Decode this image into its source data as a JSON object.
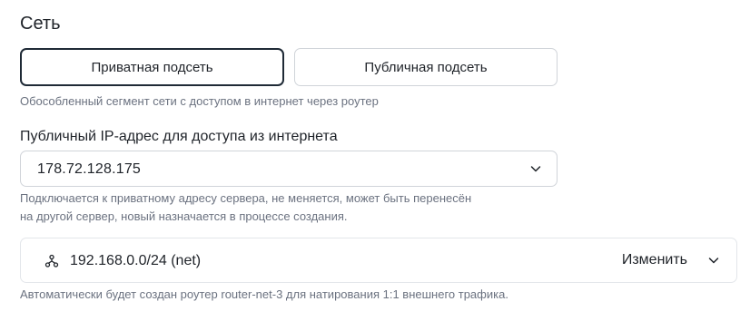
{
  "section": {
    "title": "Сеть"
  },
  "subnet_toggle": {
    "options": [
      {
        "label": "Приватная подсеть",
        "selected": true
      },
      {
        "label": "Публичная подсеть",
        "selected": false
      }
    ],
    "hint": "Обособленный сегмент сети с доступом в интернет через роутер"
  },
  "public_ip": {
    "label": "Публичный IP-адрес для доступа из интернета",
    "value": "178.72.128.175",
    "hint_line1": "Подключается к приватному адресу сервера, не меняется, может быть перенесён",
    "hint_line2": "на другой сервер, новый назначается в процессе создания."
  },
  "network": {
    "icon": "network-icon",
    "label": "192.168.0.0/24 (net)",
    "change_label": "Изменить",
    "hint": "Автоматически будет создан роутер router-net-3 для натирования 1:1 внешнего трафика."
  },
  "colors": {
    "text": "#1f2329",
    "muted": "#6b7280",
    "border": "#d0d4d9",
    "selected_border": "#1f2a36"
  }
}
